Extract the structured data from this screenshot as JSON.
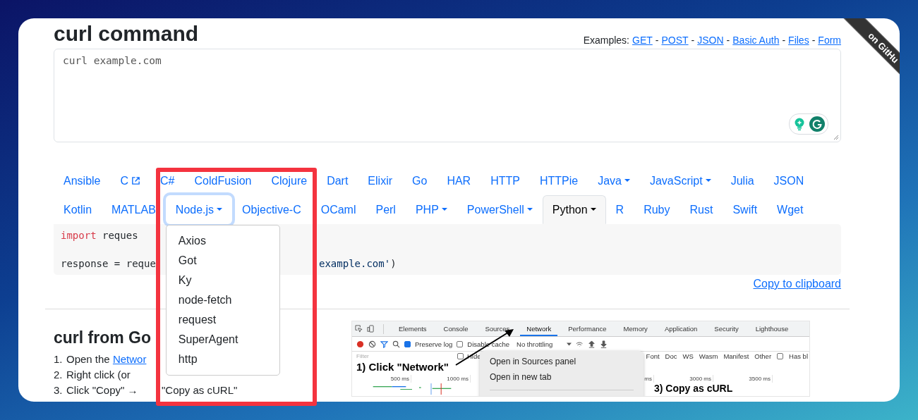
{
  "header": {
    "title": "curl command",
    "examples_label": "Examples:",
    "separator": "-",
    "examples": [
      "GET",
      "POST",
      "JSON",
      "Basic Auth",
      "Files",
      "Form"
    ]
  },
  "ribbon": {
    "text": "on GitHu"
  },
  "input": {
    "value": "curl example.com"
  },
  "tabs": [
    {
      "label": "Ansible",
      "kind": "link",
      "selected": false,
      "focused": false,
      "expanded": false
    },
    {
      "label": "C",
      "kind": "external",
      "selected": false,
      "focused": false,
      "expanded": false
    },
    {
      "label": "C#",
      "kind": "link",
      "selected": false,
      "focused": false,
      "expanded": false
    },
    {
      "label": "ColdFusion",
      "kind": "link",
      "selected": false,
      "focused": false,
      "expanded": false
    },
    {
      "label": "Clojure",
      "kind": "link",
      "selected": false,
      "focused": false,
      "expanded": false
    },
    {
      "label": "Dart",
      "kind": "link",
      "selected": false,
      "focused": false,
      "expanded": false
    },
    {
      "label": "Elixir",
      "kind": "link",
      "selected": false,
      "focused": false,
      "expanded": false
    },
    {
      "label": "Go",
      "kind": "link",
      "selected": false,
      "focused": false,
      "expanded": false
    },
    {
      "label": "HAR",
      "kind": "link",
      "selected": false,
      "focused": false,
      "expanded": false
    },
    {
      "label": "HTTP",
      "kind": "link",
      "selected": false,
      "focused": false,
      "expanded": false
    },
    {
      "label": "HTTPie",
      "kind": "link",
      "selected": false,
      "focused": false,
      "expanded": false
    },
    {
      "label": "Java",
      "kind": "dropdown",
      "selected": false,
      "focused": false,
      "expanded": false
    },
    {
      "label": "JavaScript",
      "kind": "dropdown",
      "selected": false,
      "focused": false,
      "expanded": false
    },
    {
      "label": "Julia",
      "kind": "link",
      "selected": false,
      "focused": false,
      "expanded": false
    },
    {
      "label": "JSON",
      "kind": "link",
      "selected": false,
      "focused": false,
      "expanded": false
    },
    {
      "label": "Kotlin",
      "kind": "link",
      "selected": false,
      "focused": false,
      "expanded": false
    },
    {
      "label": "MATLAB",
      "kind": "link",
      "selected": false,
      "focused": false,
      "expanded": false
    },
    {
      "label": "Node.js",
      "kind": "dropdown",
      "selected": false,
      "focused": true,
      "expanded": true,
      "menu": [
        "Axios",
        "Got",
        "Ky",
        "node-fetch",
        "request",
        "SuperAgent",
        "http"
      ]
    },
    {
      "label": "Objective-C",
      "kind": "link",
      "selected": false,
      "focused": false,
      "expanded": false
    },
    {
      "label": "OCaml",
      "kind": "link",
      "selected": false,
      "focused": false,
      "expanded": false
    },
    {
      "label": "Perl",
      "kind": "link",
      "selected": false,
      "focused": false,
      "expanded": false
    },
    {
      "label": "PHP",
      "kind": "dropdown",
      "selected": false,
      "focused": false,
      "expanded": false
    },
    {
      "label": "PowerShell",
      "kind": "dropdown",
      "selected": false,
      "focused": false,
      "expanded": false
    },
    {
      "label": "Python",
      "kind": "dropdown",
      "selected": true,
      "focused": false,
      "expanded": false
    },
    {
      "label": "R",
      "kind": "link",
      "selected": false,
      "focused": false,
      "expanded": false
    },
    {
      "label": "Ruby",
      "kind": "link",
      "selected": false,
      "focused": false,
      "expanded": false
    },
    {
      "label": "Rust",
      "kind": "link",
      "selected": false,
      "focused": false,
      "expanded": false
    },
    {
      "label": "Swift",
      "kind": "link",
      "selected": false,
      "focused": false,
      "expanded": false
    },
    {
      "label": "Wget",
      "kind": "link",
      "selected": false,
      "focused": false,
      "expanded": false
    }
  ],
  "code": {
    "lines": [
      {
        "segments": [
          {
            "kind": "keyword",
            "text": "import"
          },
          {
            "kind": "plain",
            "text": " reques"
          }
        ]
      },
      {
        "segments": [
          {
            "kind": "plain",
            "text": "response = reque"
          }
        ],
        "tail": [
          {
            "kind": "string",
            "text": "example.com'"
          },
          {
            "kind": "plain",
            "text": ")"
          }
        ]
      }
    ]
  },
  "copy_link": "Copy to clipboard",
  "chrome_section": {
    "title": "curl from Go",
    "steps": [
      {
        "number": "1.",
        "text": "Open the ",
        "link": "Networ"
      },
      {
        "number": "2.",
        "text": "Right click (or"
      },
      {
        "number": "3.",
        "text": "Click \"Copy\" →",
        "rest": "\"Copy as cURL\""
      }
    ]
  },
  "devtools_screenshot": {
    "tabs": [
      {
        "label": "Elements",
        "selected": false
      },
      {
        "label": "Console",
        "selected": false
      },
      {
        "label": "Sources",
        "selected": false
      },
      {
        "label": "Network",
        "selected": true
      },
      {
        "label": "Performance",
        "selected": false
      },
      {
        "label": "Memory",
        "selected": false
      },
      {
        "label": "Application",
        "selected": false
      },
      {
        "label": "Security",
        "selected": false
      },
      {
        "label": "Lighthouse",
        "selected": false
      }
    ],
    "preserve_log": {
      "label": "Preserve log",
      "checked": true
    },
    "disable_cache": {
      "label": "Disable cache",
      "checked": false
    },
    "throttling": "No throttling",
    "filter": {
      "placeholder": "Filter"
    },
    "hide_option": {
      "label": "Hide",
      "checked": false
    },
    "types": [
      "Font",
      "Doc",
      "WS",
      "Wasm",
      "Manifest",
      "Other"
    ],
    "blocked_option": {
      "label": "Has bl",
      "checked": false
    },
    "ticks": [
      "500 ms",
      "1000 ms",
      "ms",
      "3000 ms",
      "3500 ms"
    ],
    "context_menu": [
      "Open in Sources panel",
      "Open in new tab"
    ],
    "callouts": [
      "1) Click \"Network\"",
      "3) Copy as cURL"
    ]
  }
}
